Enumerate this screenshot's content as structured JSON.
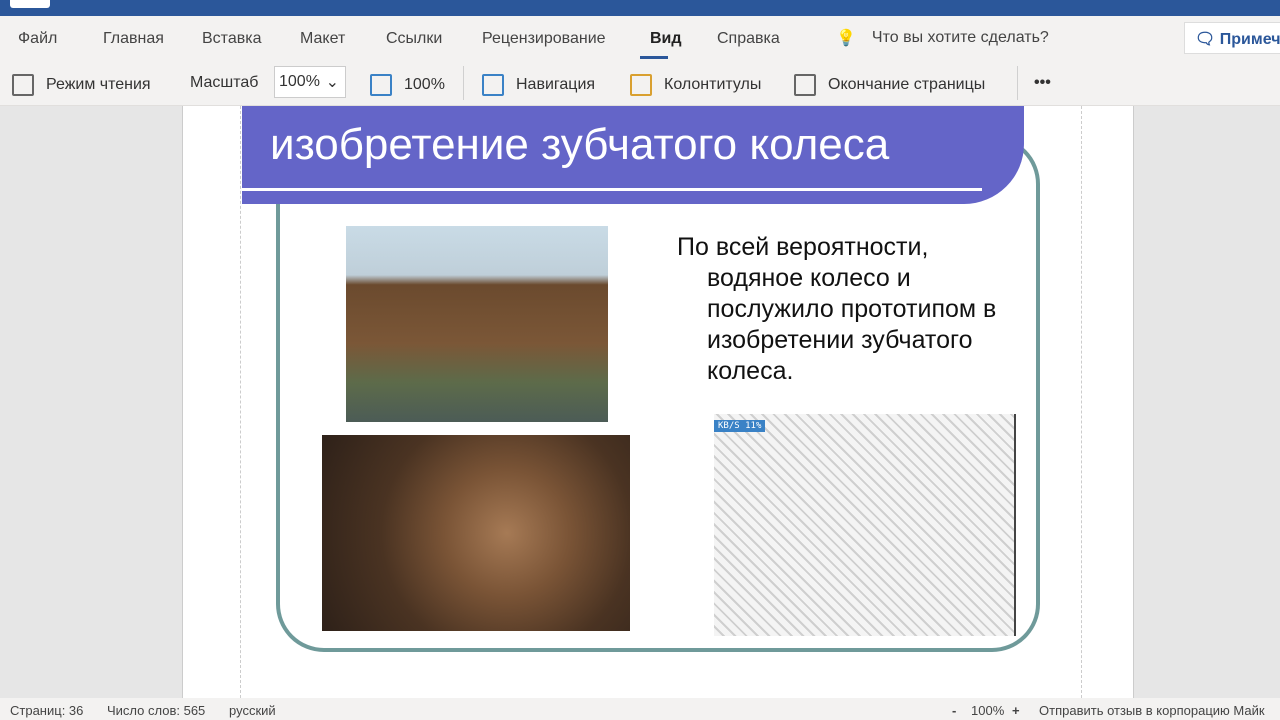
{
  "menu": {
    "tabs": [
      "Файл",
      "Главная",
      "Вставка",
      "Макет",
      "Ссылки",
      "Рецензирование",
      "Вид",
      "Справка"
    ],
    "active": "Вид",
    "search": "Что вы хотите сделать?",
    "comments": "Примеч"
  },
  "toolbar": {
    "reading_mode": "Режим чтения",
    "zoom_label": "Масштаб",
    "zoom_value": "100%",
    "page_width": "100%",
    "navigation": "Навигация",
    "headers_footers": "Колонтитулы",
    "page_break": "Окончание страницы",
    "more": "•••"
  },
  "slide": {
    "title": "изобретение зубчатого колеса",
    "text": "По всей вероятности, водяное колесо и послужило прототипом в изобретении зубчатого колеса.",
    "overlay_speed": "KB/S",
    "overlay_percent": "11%"
  },
  "status": {
    "pages": "Страниц: 36",
    "words": "Число слов: 565",
    "language": "русский",
    "zoom_minus": "-",
    "zoom": "100%",
    "zoom_plus": "+",
    "feedback": "Отправить отзыв в корпорацию Майк"
  }
}
